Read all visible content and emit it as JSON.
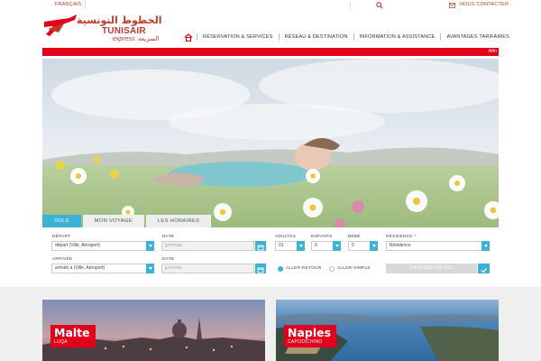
{
  "topbar": {
    "language": "FRANÇAIS",
    "contact": "NOUS CONTACTER"
  },
  "logo": {
    "arabic": "الخطوط التونسية",
    "name": "TUNISAIR",
    "express": "express",
    "express_arabic": "السريعة"
  },
  "nav": {
    "items": [
      {
        "label": "RÉSERVATION & SERVICES"
      },
      {
        "label": "RÉSEAU & DESTINATION"
      },
      {
        "label": "INFORMATION & ASSISTANCE"
      },
      {
        "label": "AVANTAGES TARIFAIRES"
      }
    ]
  },
  "ticker": {
    "text": "Afin"
  },
  "tabs": [
    {
      "label": "VOLS",
      "active": true
    },
    {
      "label": "MON VOYAGE",
      "active": false
    },
    {
      "label": "LES HORAIRES",
      "active": false
    }
  ],
  "form": {
    "depart_label": "DÉPART",
    "depart_value": "départ (Ville, Aéroport)",
    "arrivee_label": "ARRIVÉE",
    "arrivee_value": "arrivée à (Ville, Aéroport)",
    "date_label": "DATE",
    "date_placeholder": "jj/mm/aa",
    "date2_label": "DATE",
    "date2_placeholder": "jj/mm/aa",
    "adultes_label": "ADULTES",
    "adultes_value": "01",
    "enfants_label": "ENFANTS",
    "enfants_value": "0",
    "bebe_label": "BÉBÉ",
    "bebe_value": "0",
    "residence_label": "RÉSIDENCE *",
    "residence_value": "Résidence",
    "aller_retour": "ALLER-RETOUR",
    "aller_simple": "ALLER-SIMPLE",
    "submit": "TROUVER UN VOL"
  },
  "cards": [
    {
      "city": "Malte",
      "airport": "LUQA"
    },
    {
      "city": "Naples",
      "airport": "CAPODICHINO"
    }
  ],
  "colors": {
    "brand_red": "#e3001b",
    "accent_blue": "#3eb2d4"
  }
}
